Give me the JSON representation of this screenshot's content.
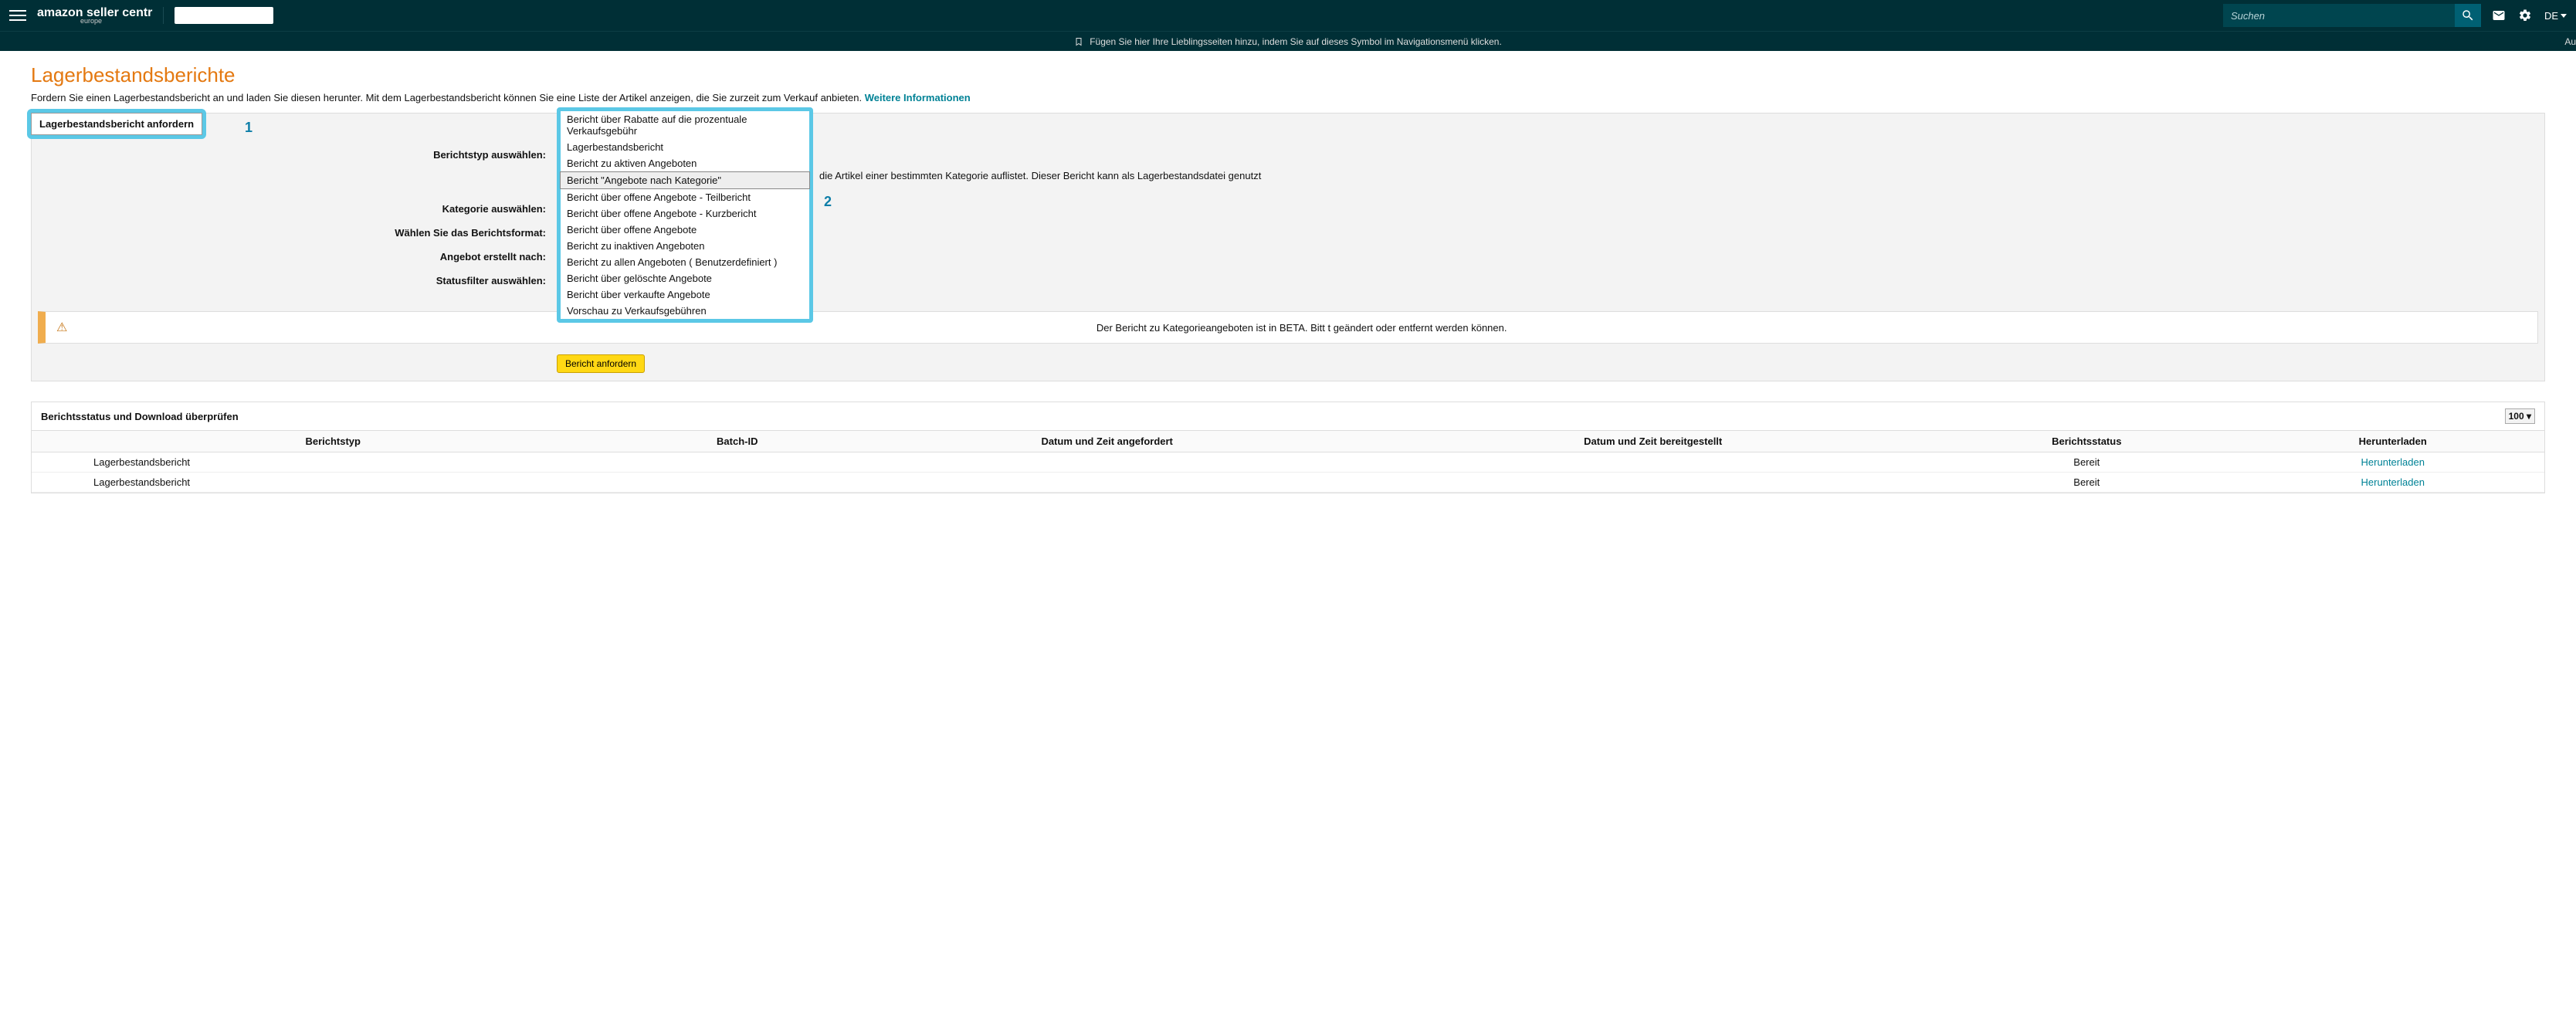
{
  "header": {
    "logo_main": "amazon seller centr",
    "logo_sub": "europe",
    "search_placeholder": "Suchen",
    "lang": "DE"
  },
  "bookmark_bar": {
    "text": "Fügen Sie hier Ihre Lieblingsseiten hinzu, indem Sie auf dieses Symbol im Navigationsmenü klicken.",
    "right_cut": "Au"
  },
  "page": {
    "title": "Lagerbestandsberichte",
    "subtext": "Fordern Sie einen Lagerbestandsbericht an und laden Sie diesen herunter. Mit dem Lagerbestandsbericht können Sie eine Liste der Artikel anzeigen, die Sie zurzeit zum Verkauf anbieten. ",
    "more_info": "Weitere Informationen"
  },
  "request": {
    "tab_label": "Lagerbestandsbericht anfordern",
    "callout1": "1",
    "callout2": "2",
    "labels": {
      "report_type": "Berichtstyp auswählen:",
      "category": "Kategorie auswählen:",
      "format": "Wählen Sie das Berichtsformat:",
      "created_after": "Angebot erstellt nach:",
      "status_filter": "Statusfilter auswählen:"
    },
    "desc_tail": "die Artikel einer bestimmten Kategorie auflistet. Dieser Bericht kann als Lagerbestandsdatei genutzt",
    "dropdown": [
      "Bericht über Rabatte auf die prozentuale Verkaufsgebühr",
      "Lagerbestandsbericht",
      "Bericht zu aktiven Angeboten",
      "Bericht \"Angebote nach Kategorie\"",
      "Bericht über offene Angebote - Teilbericht",
      "Bericht über offene Angebote - Kurzbericht",
      "Bericht über offene Angebote",
      "Bericht zu inaktiven Angeboten",
      "Bericht zu allen Angeboten ( Benutzerdefiniert )",
      "Bericht über gelöschte Angebote",
      "Bericht über verkaufte Angebote",
      "Vorschau zu Verkaufsgebühren"
    ],
    "selected_index": 3,
    "alert": "Der Bericht zu Kategorieangeboten ist in BETA. Bitt                                                                                    t geändert oder entfernt werden können.",
    "button": "Bericht anfordern"
  },
  "status": {
    "heading": "Berichtsstatus und Download überprüfen",
    "page_size": "100",
    "columns": [
      "Berichtstyp",
      "Batch-ID",
      "Datum und Zeit angefordert",
      "Datum und Zeit bereitgestellt",
      "Berichtsstatus",
      "Herunterladen"
    ],
    "rows": [
      {
        "type": "Lagerbestandsbericht",
        "batch": "",
        "requested": "",
        "provided": "",
        "status": "Bereit",
        "download": "Herunterladen"
      },
      {
        "type": "Lagerbestandsbericht",
        "batch": "",
        "requested": "",
        "provided": "",
        "status": "Bereit",
        "download": "Herunterladen"
      }
    ]
  }
}
